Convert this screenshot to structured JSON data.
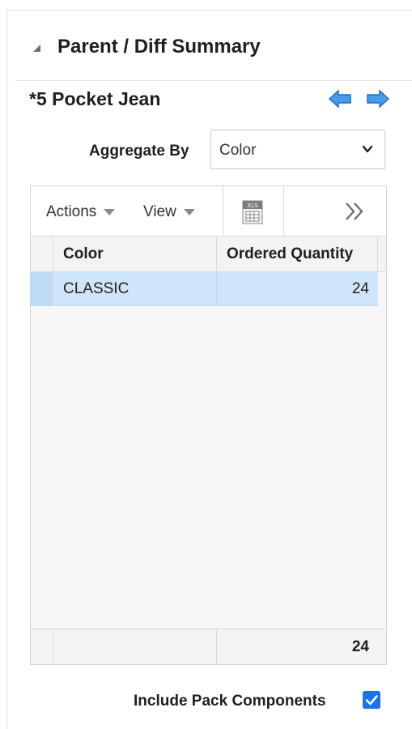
{
  "panel": {
    "title": "Parent / Diff Summary",
    "item_name": "*5 Pocket Jean",
    "nav_prev_icon": "arrow-left-icon",
    "nav_next_icon": "arrow-right-icon",
    "accent_color": "#3d8fe0"
  },
  "aggregate": {
    "label": "Aggregate By",
    "selected": "Color"
  },
  "toolbar": {
    "actions_label": "Actions",
    "view_label": "View",
    "export_icon": "xls-export-icon",
    "more_icon": "double-chevron-right-icon"
  },
  "table": {
    "columns": [
      "Color",
      "Ordered Quantity"
    ],
    "rows": [
      {
        "color": "CLASSIC",
        "ordered_quantity": "24"
      }
    ],
    "footer": {
      "ordered_quantity_total": "24"
    },
    "selected_row_color": "#cfe5f9"
  },
  "options": {
    "include_pack_components_label": "Include Pack Components",
    "include_pack_components_checked": true
  }
}
